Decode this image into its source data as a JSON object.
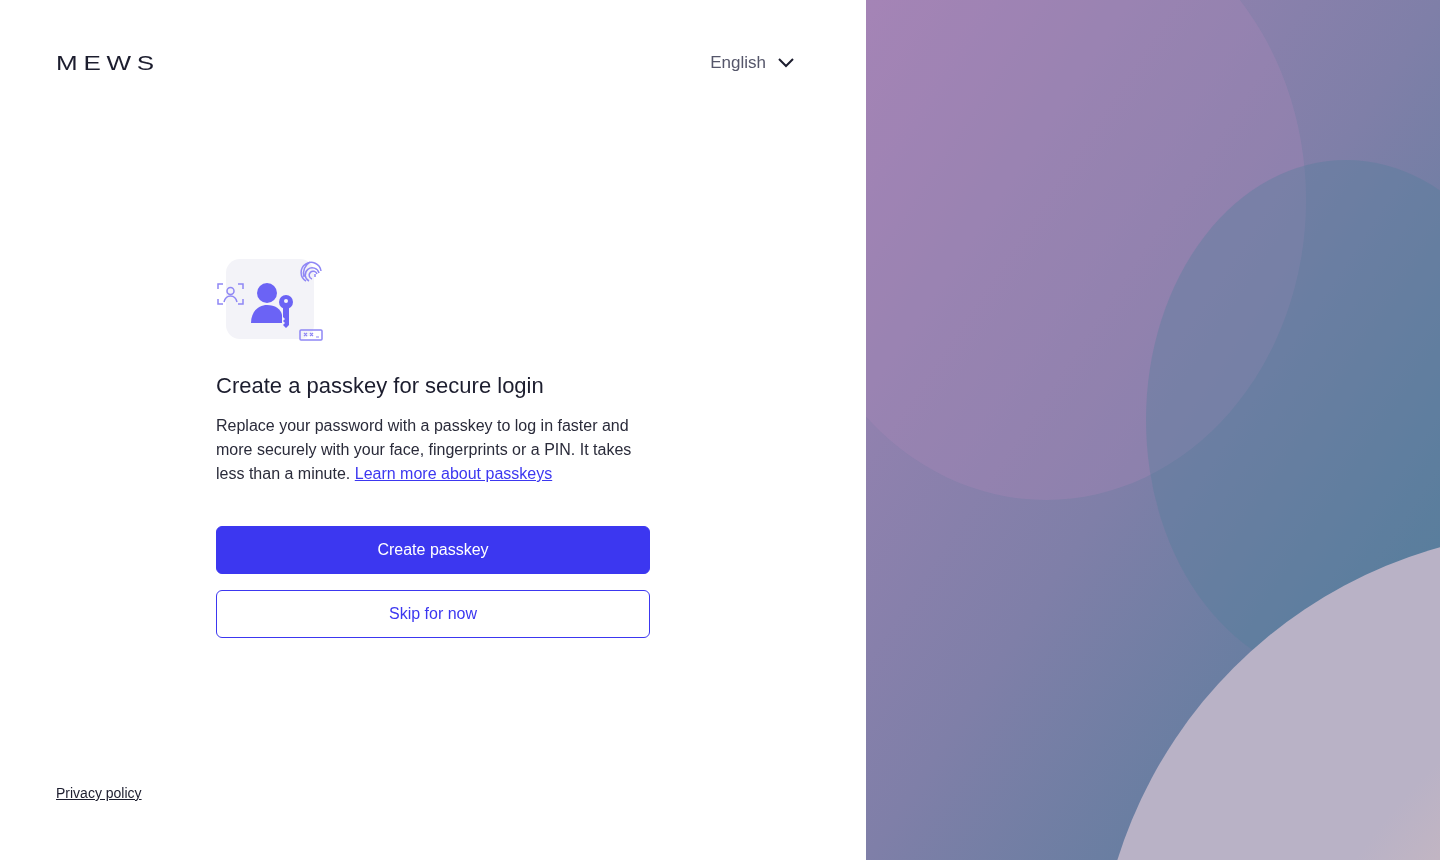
{
  "logo": "MEWS",
  "language": {
    "label": "English"
  },
  "title": "Create a passkey for secure login",
  "description": "Replace your password with a passkey to log in faster and more securely with your face, fingerprints or a PIN. It takes less than a minute.",
  "learn_more_link": "Learn more about passkeys",
  "buttons": [
    {
      "label": "Create passkey",
      "kind": "primary"
    },
    {
      "label": "Skip for now",
      "kind": "secondary"
    }
  ],
  "footer": {
    "privacy_link": "Privacy policy"
  }
}
